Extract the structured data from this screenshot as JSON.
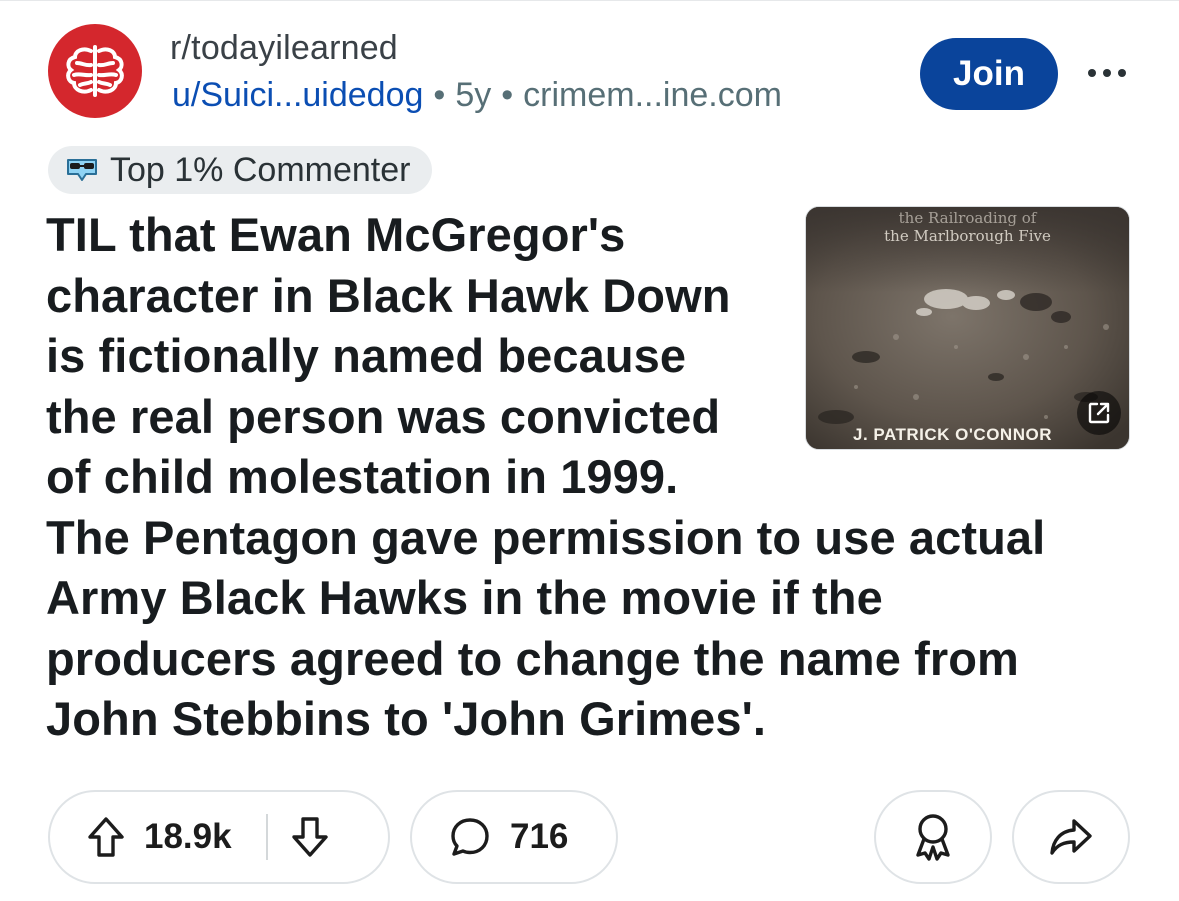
{
  "post": {
    "subreddit": "r/todayilearned",
    "username": "u/Suici...uidedog",
    "age": "5y",
    "domain": "crimem...ine.com",
    "separator": "•",
    "join_label": "Join",
    "flair": {
      "label": "Top 1% Commenter",
      "icon": "sunglasses-emoji-icon"
    },
    "title_lines": [
      "TIL that Ewan McGregor's",
      "character in Black Hawk Down",
      "is fictionally named because",
      "the real person was convicted",
      "of child molestation in 1999.",
      "The Pentagon gave permission to use actual",
      "Army Black Hawks in the movie if the",
      "producers agreed to change the name from",
      "John Stebbins to 'John Grimes'."
    ],
    "thumbnail": {
      "top_text": "the Marlborough Five",
      "top_partial_text": "the Railroading of",
      "bottom_text": "J. PATRICK O'CONNOR"
    }
  },
  "actions": {
    "votes": "18.9k",
    "comments": "716"
  },
  "colors": {
    "brand_red": "#d4272d",
    "join_blue": "#0a449b",
    "link_blue": "#0b4eb3",
    "meta_gray": "#576f76"
  }
}
